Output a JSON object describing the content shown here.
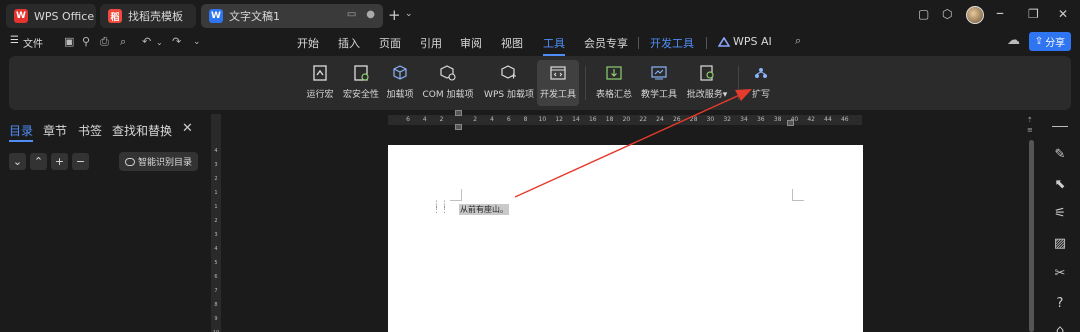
{
  "tabs": [
    {
      "label": "WPS Office",
      "icon": "wps-logo-icon"
    },
    {
      "label": "找稻壳模板",
      "icon": "docer-logo-icon"
    },
    {
      "label": "文字文稿1",
      "icon": "word-doc-icon"
    }
  ],
  "file_menu": {
    "label": "文件"
  },
  "menu_items": [
    "开始",
    "插入",
    "页面",
    "引用",
    "审阅",
    "视图",
    "工具",
    "会员专享",
    "开发工具",
    "WPS AI"
  ],
  "active_menu": "工具",
  "share_label": "分享",
  "ribbon": [
    {
      "label": "运行宏",
      "icon": "run-macro-icon"
    },
    {
      "label": "宏安全性",
      "icon": "macro-security-icon"
    },
    {
      "label": "加载项",
      "icon": "addin-cube-icon"
    },
    {
      "label": "COM 加载项",
      "icon": "com-addin-icon"
    },
    {
      "label": "WPS 加载项",
      "icon": "wps-addin-icon"
    },
    {
      "label": "开发工具",
      "icon": "developer-tools-icon"
    },
    {
      "label": "表格汇总",
      "icon": "table-summary-icon"
    },
    {
      "label": "教学工具",
      "icon": "teaching-tools-icon"
    },
    {
      "label": "批改服务",
      "icon": "correction-service-icon"
    },
    {
      "label": "扩写",
      "icon": "expand-writing-icon"
    }
  ],
  "nav": {
    "tabs": [
      "目录",
      "章节",
      "书签",
      "查找和替换"
    ],
    "smart_button": "智能识别目录"
  },
  "hruler_labels": [
    "6",
    "4",
    "2",
    "2",
    "4",
    "6",
    "8",
    "10",
    "12",
    "14",
    "16",
    "18",
    "20",
    "22",
    "24",
    "26",
    "28",
    "30",
    "32",
    "34",
    "36",
    "38",
    "40",
    "42",
    "44",
    "46"
  ],
  "vruler_labels": [
    "4",
    "3",
    "2",
    "1",
    "1",
    "2",
    "3",
    "4",
    "5",
    "6",
    "7",
    "8",
    "9",
    "10"
  ],
  "document": {
    "text": "从前有座山。"
  },
  "colors": {
    "accent": "#4f8ef7",
    "share": "#2f74f0",
    "arrow": "#e53b2c"
  }
}
